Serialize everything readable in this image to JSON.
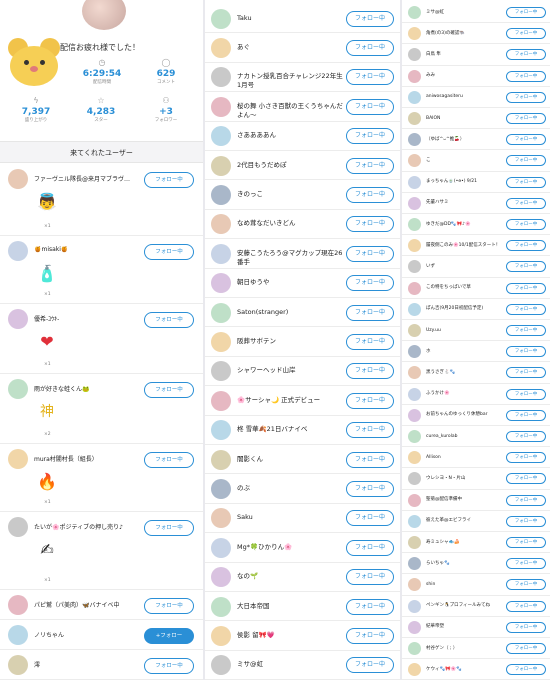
{
  "header": {
    "greeting": "配信お疲れ様でした！",
    "stats": [
      {
        "icon": "◷",
        "value": "6:29:54",
        "label": "配信時間"
      },
      {
        "icon": "◯",
        "value": "629",
        "label": "コメント"
      },
      {
        "icon": "ϟ",
        "value": "7,397",
        "label": "盛り上がり"
      },
      {
        "icon": "☆",
        "value": "4,283",
        "label": "スター"
      },
      {
        "icon": "⚇",
        "value": "+3",
        "label": "フォロワー"
      }
    ]
  },
  "section_title": "来てくれたユーザー",
  "follow_label": "フォロー中",
  "follow_new_label": "+フォロー",
  "panel1_users": [
    {
      "name": "ファーヴニル隊長@来月マブラヴ…",
      "gift": "👼",
      "count": "×1"
    },
    {
      "name": "🍯misaki🍯",
      "gift": "🧴",
      "count": "×1"
    },
    {
      "name": "優希-ﾕｳｷ-",
      "gift": "❤",
      "count": "×1"
    },
    {
      "name": "雨が好きな蛙くん🐸",
      "gift": "神",
      "count": "×2"
    },
    {
      "name": "mura村闇村長（組長）",
      "gift": "🔥",
      "count": "×1"
    },
    {
      "name": "たいが🌸ポジティブの押し売り♪",
      "gift": "✍",
      "count": "×1"
    },
    {
      "name": "パピ鷲（パ美肉）🦋バナイベ中",
      "gift": "",
      "count": ""
    },
    {
      "name": "ノリちゃん",
      "gift": "",
      "count": ""
    },
    {
      "name": "澪",
      "gift": "",
      "count": ""
    }
  ],
  "panel2_users": [
    "Taku",
    "あぐ",
    "ナカトン授乳百合チャレンジ22年生1月号",
    "桜の舞 小さき百獣の王くうちゃんだよん〜",
    "さああああん",
    "2代目もうだめぽ",
    "きのっこ",
    "なめ茸なだいきどん",
    "安藤こうたろう@マグカップ現在26番手",
    "朝日ゆうや",
    "Saton(stranger)",
    "阪葬サボテン",
    "シャワーヘッド山岸",
    "🌸サーシャ🌙 正式デビュー",
    "柊 雪華🍂21日バナイベ",
    "闇影くん",
    "のぶ",
    "Saku",
    "Mg*🍀ひかりん🌸",
    "なの🌱",
    "大日本帝国",
    "侯影 留🎀💗",
    "ミサ@虹"
  ],
  "panel3_users": [
    "ミサ@虹",
    "角煮(の3)の確認🐃",
    "白鳥 隼",
    "みみ",
    "aniwosagasiteru",
    "BAION",
    "（ゆば^ᴗ^推🍒）",
    "こ",
    "まっちゃん🍵(•ө•) 9/21",
    "先輩ハサミ",
    "ゆきだ@DD🐾🎀♪🌸",
    "履夜側このみ🌸10/1配信スタート！",
    "いず",
    "この特をちっぱいで草",
    "ぽん吉(9月20日初配信予定)",
    "Uzy.uu",
    "ホ",
    "黒うさぎ🐇🐾",
    "ふうかけ🌸",
    "お前ちゃんのゆっくり休憩bar",
    "curea_kurolab",
    "Allison",
    "ウレシヨ・N・片山",
    "聖菊@配信準備中",
    "彼えた革@エビフライ",
    "寿ミュシャ🐟🍰",
    "らいちゃ🐾",
    "shin",
    "ペンギン🐧プロフィールみてね",
    "紀華帝塑",
    "村谷ゲン（ ; ）",
    "ケウィ🐾🎀🌸🐾"
  ],
  "colors": {
    "accent": "#2a8fd6",
    "divider": "#ececec",
    "section_bg": "#f4f4f6"
  }
}
